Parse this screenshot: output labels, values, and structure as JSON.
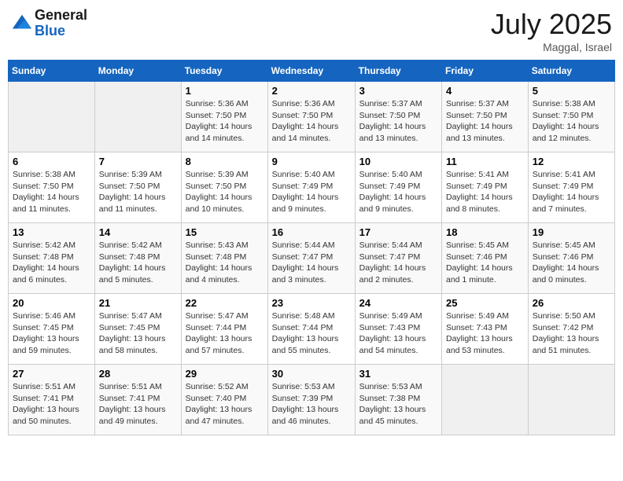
{
  "header": {
    "logo_line1": "General",
    "logo_line2": "Blue",
    "month": "July 2025",
    "location": "Maggal, Israel"
  },
  "weekdays": [
    "Sunday",
    "Monday",
    "Tuesday",
    "Wednesday",
    "Thursday",
    "Friday",
    "Saturday"
  ],
  "weeks": [
    [
      {
        "day": "",
        "info": ""
      },
      {
        "day": "",
        "info": ""
      },
      {
        "day": "1",
        "info": "Sunrise: 5:36 AM\nSunset: 7:50 PM\nDaylight: 14 hours and 14 minutes."
      },
      {
        "day": "2",
        "info": "Sunrise: 5:36 AM\nSunset: 7:50 PM\nDaylight: 14 hours and 14 minutes."
      },
      {
        "day": "3",
        "info": "Sunrise: 5:37 AM\nSunset: 7:50 PM\nDaylight: 14 hours and 13 minutes."
      },
      {
        "day": "4",
        "info": "Sunrise: 5:37 AM\nSunset: 7:50 PM\nDaylight: 14 hours and 13 minutes."
      },
      {
        "day": "5",
        "info": "Sunrise: 5:38 AM\nSunset: 7:50 PM\nDaylight: 14 hours and 12 minutes."
      }
    ],
    [
      {
        "day": "6",
        "info": "Sunrise: 5:38 AM\nSunset: 7:50 PM\nDaylight: 14 hours and 11 minutes."
      },
      {
        "day": "7",
        "info": "Sunrise: 5:39 AM\nSunset: 7:50 PM\nDaylight: 14 hours and 11 minutes."
      },
      {
        "day": "8",
        "info": "Sunrise: 5:39 AM\nSunset: 7:50 PM\nDaylight: 14 hours and 10 minutes."
      },
      {
        "day": "9",
        "info": "Sunrise: 5:40 AM\nSunset: 7:49 PM\nDaylight: 14 hours and 9 minutes."
      },
      {
        "day": "10",
        "info": "Sunrise: 5:40 AM\nSunset: 7:49 PM\nDaylight: 14 hours and 9 minutes."
      },
      {
        "day": "11",
        "info": "Sunrise: 5:41 AM\nSunset: 7:49 PM\nDaylight: 14 hours and 8 minutes."
      },
      {
        "day": "12",
        "info": "Sunrise: 5:41 AM\nSunset: 7:49 PM\nDaylight: 14 hours and 7 minutes."
      }
    ],
    [
      {
        "day": "13",
        "info": "Sunrise: 5:42 AM\nSunset: 7:48 PM\nDaylight: 14 hours and 6 minutes."
      },
      {
        "day": "14",
        "info": "Sunrise: 5:42 AM\nSunset: 7:48 PM\nDaylight: 14 hours and 5 minutes."
      },
      {
        "day": "15",
        "info": "Sunrise: 5:43 AM\nSunset: 7:48 PM\nDaylight: 14 hours and 4 minutes."
      },
      {
        "day": "16",
        "info": "Sunrise: 5:44 AM\nSunset: 7:47 PM\nDaylight: 14 hours and 3 minutes."
      },
      {
        "day": "17",
        "info": "Sunrise: 5:44 AM\nSunset: 7:47 PM\nDaylight: 14 hours and 2 minutes."
      },
      {
        "day": "18",
        "info": "Sunrise: 5:45 AM\nSunset: 7:46 PM\nDaylight: 14 hours and 1 minute."
      },
      {
        "day": "19",
        "info": "Sunrise: 5:45 AM\nSunset: 7:46 PM\nDaylight: 14 hours and 0 minutes."
      }
    ],
    [
      {
        "day": "20",
        "info": "Sunrise: 5:46 AM\nSunset: 7:45 PM\nDaylight: 13 hours and 59 minutes."
      },
      {
        "day": "21",
        "info": "Sunrise: 5:47 AM\nSunset: 7:45 PM\nDaylight: 13 hours and 58 minutes."
      },
      {
        "day": "22",
        "info": "Sunrise: 5:47 AM\nSunset: 7:44 PM\nDaylight: 13 hours and 57 minutes."
      },
      {
        "day": "23",
        "info": "Sunrise: 5:48 AM\nSunset: 7:44 PM\nDaylight: 13 hours and 55 minutes."
      },
      {
        "day": "24",
        "info": "Sunrise: 5:49 AM\nSunset: 7:43 PM\nDaylight: 13 hours and 54 minutes."
      },
      {
        "day": "25",
        "info": "Sunrise: 5:49 AM\nSunset: 7:43 PM\nDaylight: 13 hours and 53 minutes."
      },
      {
        "day": "26",
        "info": "Sunrise: 5:50 AM\nSunset: 7:42 PM\nDaylight: 13 hours and 51 minutes."
      }
    ],
    [
      {
        "day": "27",
        "info": "Sunrise: 5:51 AM\nSunset: 7:41 PM\nDaylight: 13 hours and 50 minutes."
      },
      {
        "day": "28",
        "info": "Sunrise: 5:51 AM\nSunset: 7:41 PM\nDaylight: 13 hours and 49 minutes."
      },
      {
        "day": "29",
        "info": "Sunrise: 5:52 AM\nSunset: 7:40 PM\nDaylight: 13 hours and 47 minutes."
      },
      {
        "day": "30",
        "info": "Sunrise: 5:53 AM\nSunset: 7:39 PM\nDaylight: 13 hours and 46 minutes."
      },
      {
        "day": "31",
        "info": "Sunrise: 5:53 AM\nSunset: 7:38 PM\nDaylight: 13 hours and 45 minutes."
      },
      {
        "day": "",
        "info": ""
      },
      {
        "day": "",
        "info": ""
      }
    ]
  ]
}
